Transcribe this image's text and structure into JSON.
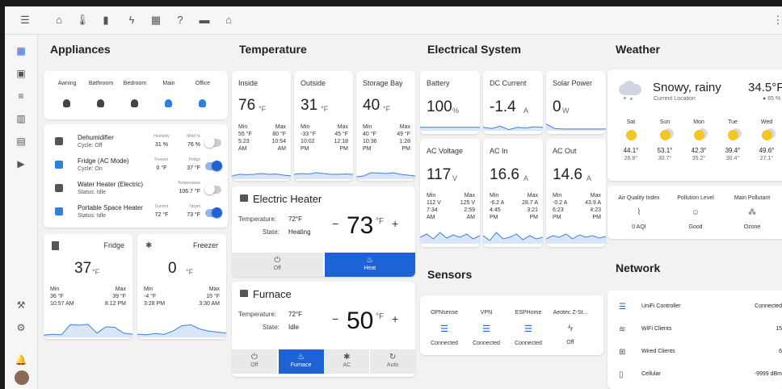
{
  "topbar": {
    "icons": [
      "menu-icon",
      "home-icon",
      "thermometer-icon",
      "trash-bin-icon",
      "lightning-icon",
      "radiator-icon",
      "question-icon",
      "car-icon",
      "house-tech-icon",
      "more-vertical-icon"
    ]
  },
  "sidebar": {
    "items": [
      "dashboard-icon",
      "contacts-icon",
      "list-icon",
      "chart-icon",
      "calendar-icon",
      "media-icon",
      "wrench-icon",
      "gear-icon",
      "bell-icon",
      "avatar"
    ]
  },
  "columns": {
    "appliances": "Appliances",
    "temperature": "Temperature",
    "electrical": "Electrical System",
    "weather": "Weather",
    "sensors": "Sensors",
    "network": "Network"
  },
  "lights": [
    {
      "label": "Awning",
      "on": false
    },
    {
      "label": "Bathroom",
      "on": false
    },
    {
      "label": "Bedroom",
      "on": false
    },
    {
      "label": "Main",
      "on": true
    },
    {
      "label": "Office",
      "on": true
    }
  ],
  "appliances": [
    {
      "name": "Dehumidifier",
      "status": "Cycle: Off",
      "a_label": "Humidity",
      "a_value": "31 %",
      "b_label": "Mold %",
      "b_value": "76 %",
      "toggle": false
    },
    {
      "name": "Fridge (AC Mode)",
      "status": "Cycle: On",
      "a_label": "Freezer",
      "a_value": "0 °F",
      "b_label": "Fridge",
      "b_value": "37 °F",
      "toggle": true
    },
    {
      "name": "Water Heater (Electric)",
      "status": "Status: Idle",
      "a_label": "",
      "a_value": "",
      "b_label": "Temperature",
      "b_value": "106.7 °F",
      "toggle": false
    },
    {
      "name": "Portable Space Heater",
      "status": "Status: Idle",
      "a_label": "Current",
      "a_value": "72 °F",
      "b_label": "Target",
      "b_value": "73 °F",
      "toggle": true
    }
  ],
  "fridge_cards": [
    {
      "title": "Fridge",
      "value": "37",
      "unit": "°F",
      "min_label": "Min",
      "min_value": "36 °F",
      "min_time": "10:57 AM",
      "max_label": "Max",
      "max_value": "39 °F",
      "max_time": "8:12 PM"
    },
    {
      "title": "Freezer",
      "value": "0",
      "unit": "°F",
      "min_label": "Min",
      "min_value": "-4 °F",
      "min_time": "3:28 PM",
      "max_label": "Max",
      "max_value": "15 °F",
      "max_time": "3:30 AM"
    }
  ],
  "temps": [
    {
      "title": "Inside",
      "value": "76",
      "unit": "°F",
      "min_label": "Min",
      "min_value": "55 °F",
      "min_time": "5:23",
      "min_ampm": "AM",
      "max_label": "Max",
      "max_value": "80 °F",
      "max_time": "10:54",
      "max_ampm": "AM"
    },
    {
      "title": "Outside",
      "value": "31",
      "unit": "°F",
      "min_label": "Min",
      "min_value": "-33 °F",
      "min_time": "10:02",
      "min_ampm": "PM",
      "max_label": "Max",
      "max_value": "45 °F",
      "max_time": "12:18",
      "max_ampm": "PM"
    },
    {
      "title": "Storage Bay",
      "value": "40",
      "unit": "°F",
      "min_label": "Min",
      "min_value": "40 °F",
      "min_time": "10:36",
      "min_ampm": "PM",
      "max_label": "Max",
      "max_value": "49 °F",
      "max_time": "1:28",
      "max_ampm": "PM"
    }
  ],
  "thermostats": [
    {
      "title": "Electric Heater",
      "temp_label": "Temperature:",
      "temp_value": "72°F",
      "state_label": "State:",
      "state_value": "Heating",
      "target": "73",
      "unit": "°F",
      "minus": "−",
      "plus": "+",
      "modes": [
        {
          "label": "Off",
          "icon": "power-icon",
          "active": false
        },
        {
          "label": "Heat",
          "icon": "flame-icon",
          "active": true
        }
      ]
    },
    {
      "title": "Furnace",
      "temp_label": "Temperature:",
      "temp_value": "72°F",
      "state_label": "State:",
      "state_value": "Idle",
      "target": "50",
      "unit": "°F",
      "minus": "−",
      "plus": "+",
      "modes": [
        {
          "label": "Off",
          "icon": "power-icon",
          "active": false
        },
        {
          "label": "Furnace",
          "icon": "flame-icon",
          "active": true
        },
        {
          "label": "AC",
          "icon": "snowflake-icon",
          "active": false
        },
        {
          "label": "Auto",
          "icon": "auto-icon",
          "active": false
        }
      ]
    }
  ],
  "electrical": [
    {
      "title": "Battery",
      "value": "100",
      "unit": "%",
      "has_mm": false
    },
    {
      "title": "DC Current",
      "value": "-1.4",
      "unit": "A",
      "has_mm": false
    },
    {
      "title": "Solar Power",
      "value": "0",
      "unit": "W",
      "has_mm": false
    },
    {
      "title": "AC Voltage",
      "value": "117",
      "unit": "V",
      "has_mm": true,
      "min_label": "Min",
      "min_value": "112 V",
      "min_time": "7:34",
      "min_ampm": "AM",
      "max_label": "Max",
      "max_value": "125 V",
      "max_time": "2:59",
      "max_ampm": "AM"
    },
    {
      "title": "AC In",
      "value": "16.6",
      "unit": "A",
      "has_mm": true,
      "min_label": "Min",
      "min_value": "-6.2 A",
      "min_time": "4:45",
      "min_ampm": "PM",
      "max_label": "Max",
      "max_value": "28.7 A",
      "max_time": "3:21",
      "max_ampm": "PM"
    },
    {
      "title": "AC Out",
      "value": "14.6",
      "unit": "A",
      "has_mm": true,
      "min_label": "Min",
      "min_value": "-0.2 A",
      "min_time": "6:23",
      "min_ampm": "PM",
      "max_label": "Max",
      "max_value": "43.9 A",
      "max_time": "4:23",
      "max_ampm": "PM"
    }
  ],
  "sensors": [
    {
      "label": "OPNsense",
      "status": "Connected",
      "icon": "server-icon"
    },
    {
      "label": "VPN",
      "status": "Connected",
      "icon": "server-icon"
    },
    {
      "label": "ESPHome",
      "status": "Connected",
      "icon": "server-icon"
    },
    {
      "label": "Aeotec Z-St...",
      "status": "Off",
      "icon": "lightning-icon"
    }
  ],
  "weather": {
    "condition": "Snowy, rainy",
    "location": "Current Location",
    "temp": "34.5°F",
    "humidity": "65 %",
    "forecast": [
      {
        "day": "Sat",
        "high": "44.1°",
        "low": "26.8°"
      },
      {
        "day": "Sun",
        "high": "53.1°",
        "low": "30.7°"
      },
      {
        "day": "Mon",
        "high": "42.3°",
        "low": "35.2°"
      },
      {
        "day": "Tue",
        "high": "39.4°",
        "low": "30.4°"
      },
      {
        "day": "Wed",
        "high": "49.6°",
        "low": "27.1°"
      }
    ]
  },
  "air": [
    {
      "label": "Air Quality Index",
      "value": "0 AQI",
      "icon": "chart-line-icon"
    },
    {
      "label": "Pollution Level",
      "value": "Good",
      "icon": "smiley-icon"
    },
    {
      "label": "Main Pollutant",
      "value": "Ozone",
      "icon": "molecule-icon"
    }
  ],
  "network": [
    {
      "label": "UniFi Controller",
      "value": "Connected",
      "icon": "server-icon"
    },
    {
      "label": "WiFi Clients",
      "value": "15",
      "icon": "wifi-icon"
    },
    {
      "label": "Wired Clients",
      "value": "6",
      "icon": "lan-icon"
    },
    {
      "label": "Cellular",
      "value": "-9999 dBm",
      "icon": "cellphone-icon"
    }
  ],
  "colors": {
    "accent": "#1e63d6",
    "graph": "#3d7fd6"
  }
}
